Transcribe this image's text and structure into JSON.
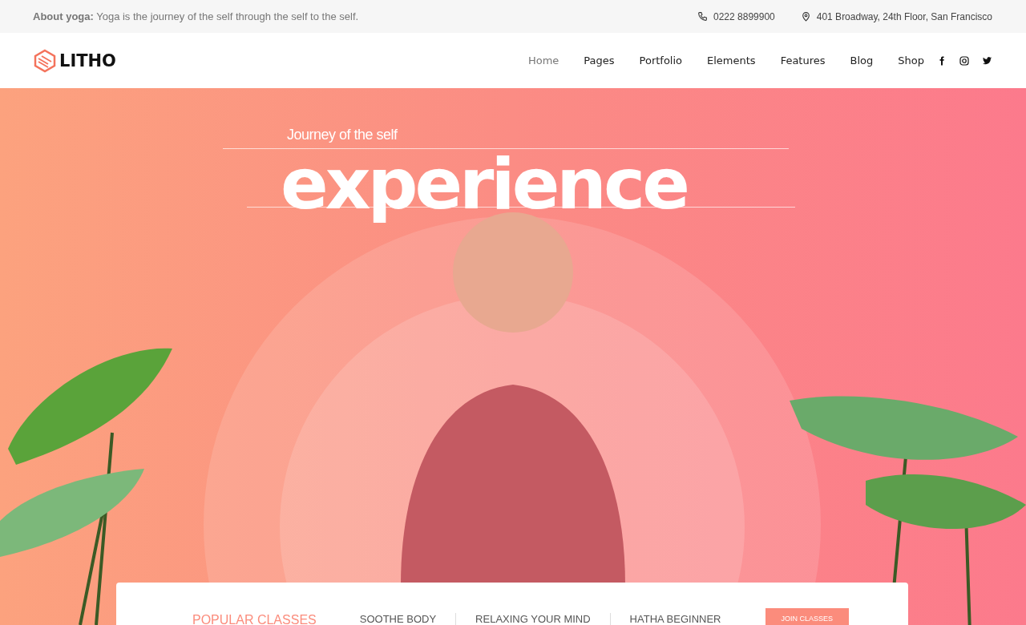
{
  "top_bar": {
    "about": "**About yoga:** Yoga is the journey of the self through the self to the self.",
    "phone": "0222 8899900",
    "address": "401 Broadway, 24th Floor, San Francisco"
  },
  "brand": "LITHO",
  "nav": [
    {
      "label": "Home",
      "selected": true
    },
    {
      "label": "Pages",
      "selected": false
    },
    {
      "label": "Portfolio",
      "selected": false
    },
    {
      "label": "Elements",
      "selected": false
    },
    {
      "label": "Features",
      "selected": false
    },
    {
      "label": "Blog",
      "selected": false
    },
    {
      "label": "Shop",
      "selected": false
    }
  ],
  "hero": {
    "subtitle": "Journey of the self",
    "title": "experience"
  },
  "classes_bar": {
    "heading": "POPULAR CLASSES",
    "items": [
      "SOOTHE BODY",
      "RELAXING YOUR MIND",
      "HATHA BEGINNER"
    ],
    "button": "JOIN CLASSES"
  }
}
